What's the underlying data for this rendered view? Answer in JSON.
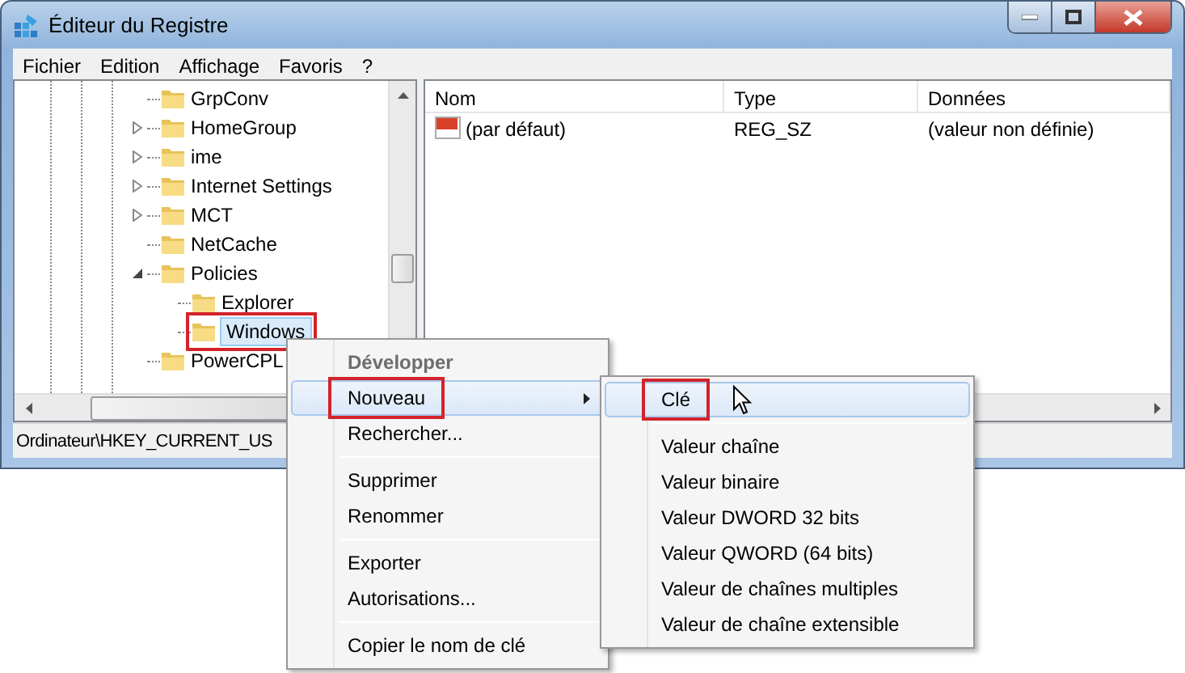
{
  "window": {
    "title": "Éditeur du Registre"
  },
  "menu_bar": [
    "Fichier",
    "Edition",
    "Affichage",
    "Favoris",
    "?"
  ],
  "tree": [
    {
      "label": "GrpConv",
      "expandable": false,
      "selected": false,
      "annotated": false
    },
    {
      "label": "HomeGroup",
      "expandable": true,
      "expanded": false,
      "selected": false,
      "annotated": false
    },
    {
      "label": "ime",
      "expandable": true,
      "expanded": false,
      "selected": false,
      "annotated": false
    },
    {
      "label": "Internet Settings",
      "expandable": true,
      "expanded": false,
      "selected": false,
      "annotated": false
    },
    {
      "label": "MCT",
      "expandable": true,
      "expanded": false,
      "selected": false,
      "annotated": false
    },
    {
      "label": "NetCache",
      "expandable": false,
      "selected": false,
      "annotated": false
    },
    {
      "label": "Policies",
      "expandable": true,
      "expanded": true,
      "selected": false,
      "annotated": false,
      "children": [
        {
          "label": "Explorer",
          "expandable": false,
          "selected": false,
          "annotated": false
        },
        {
          "label": "Windows",
          "expandable": false,
          "selected": true,
          "annotated": true
        }
      ]
    },
    {
      "label": "PowerCPL",
      "expandable": false,
      "selected": false,
      "annotated": false
    }
  ],
  "list": {
    "columns": [
      "Nom",
      "Type",
      "Données"
    ],
    "rows": [
      {
        "cells": [
          "(par défaut)",
          "REG_SZ",
          "(valeur non définie)"
        ]
      }
    ]
  },
  "status_bar": "Ordinateur\\HKEY_CURRENT_US",
  "context_menu": {
    "items": [
      {
        "kind": "item",
        "label": "Développer",
        "disabled": true,
        "bold": true,
        "selected": false,
        "submenu": false,
        "annotated": false
      },
      {
        "kind": "item",
        "label": "Nouveau",
        "disabled": false,
        "bold": false,
        "selected": true,
        "submenu": true,
        "annotated": true
      },
      {
        "kind": "item",
        "label": "Rechercher...",
        "disabled": false,
        "bold": false,
        "selected": false,
        "submenu": false,
        "annotated": false
      },
      {
        "kind": "separator"
      },
      {
        "kind": "item",
        "label": "Supprimer",
        "disabled": false,
        "bold": false,
        "selected": false,
        "submenu": false,
        "annotated": false
      },
      {
        "kind": "item",
        "label": "Renommer",
        "disabled": false,
        "bold": false,
        "selected": false,
        "submenu": false,
        "annotated": false
      },
      {
        "kind": "separator"
      },
      {
        "kind": "item",
        "label": "Exporter",
        "disabled": false,
        "bold": false,
        "selected": false,
        "submenu": false,
        "annotated": false
      },
      {
        "kind": "item",
        "label": "Autorisations...",
        "disabled": false,
        "bold": false,
        "selected": false,
        "submenu": false,
        "annotated": false
      },
      {
        "kind": "separator"
      },
      {
        "kind": "item",
        "label": "Copier le nom de clé",
        "disabled": false,
        "bold": false,
        "selected": false,
        "submenu": false,
        "annotated": false
      }
    ]
  },
  "submenu": {
    "items": [
      {
        "kind": "item",
        "label": "Clé",
        "disabled": false,
        "bold": false,
        "selected": true,
        "submenu": false,
        "annotated": true
      },
      {
        "kind": "separator"
      },
      {
        "kind": "item",
        "label": "Valeur chaîne",
        "disabled": false,
        "bold": false,
        "selected": false,
        "submenu": false,
        "annotated": false
      },
      {
        "kind": "item",
        "label": "Valeur binaire",
        "disabled": false,
        "bold": false,
        "selected": false,
        "submenu": false,
        "annotated": false
      },
      {
        "kind": "item",
        "label": "Valeur DWORD 32 bits",
        "disabled": false,
        "bold": false,
        "selected": false,
        "submenu": false,
        "annotated": false
      },
      {
        "kind": "item",
        "label": "Valeur QWORD (64 bits)",
        "disabled": false,
        "bold": false,
        "selected": false,
        "submenu": false,
        "annotated": false
      },
      {
        "kind": "item",
        "label": "Valeur de chaînes multiples",
        "disabled": false,
        "bold": false,
        "selected": false,
        "submenu": false,
        "annotated": false
      },
      {
        "kind": "item",
        "label": "Valeur de chaîne extensible",
        "disabled": false,
        "bold": false,
        "selected": false,
        "submenu": false,
        "annotated": false
      }
    ]
  }
}
